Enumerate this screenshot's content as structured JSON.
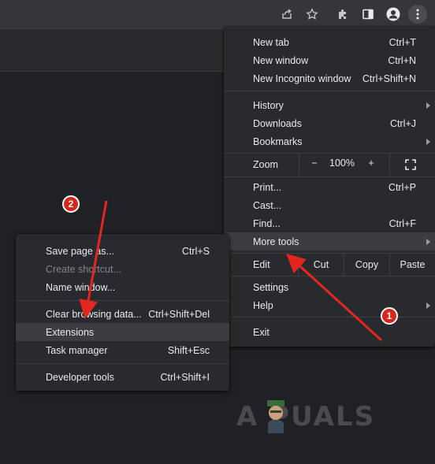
{
  "colors": {
    "background": "#202124",
    "toolbar": "#35363a",
    "menu": "#292a2d",
    "highlight": "#3c3d41",
    "annotation_red": "#d9261c"
  },
  "toolbar": {
    "icons": [
      "share-icon",
      "star-icon",
      "extensions-icon",
      "side-panel-icon",
      "profile-icon",
      "kebab-menu-icon"
    ]
  },
  "main_menu": {
    "new_tab": {
      "label": "New tab",
      "shortcut": "Ctrl+T"
    },
    "new_window": {
      "label": "New window",
      "shortcut": "Ctrl+N"
    },
    "new_incognito": {
      "label": "New Incognito window",
      "shortcut": "Ctrl+Shift+N"
    },
    "history": {
      "label": "History"
    },
    "downloads": {
      "label": "Downloads",
      "shortcut": "Ctrl+J"
    },
    "bookmarks": {
      "label": "Bookmarks"
    },
    "zoom": {
      "label": "Zoom",
      "minus": "−",
      "level": "100%",
      "plus": "+"
    },
    "print": {
      "label": "Print...",
      "shortcut": "Ctrl+P"
    },
    "cast": {
      "label": "Cast..."
    },
    "find": {
      "label": "Find...",
      "shortcut": "Ctrl+F"
    },
    "more_tools": {
      "label": "More tools"
    },
    "edit": {
      "label": "Edit",
      "cut": "Cut",
      "copy": "Copy",
      "paste": "Paste"
    },
    "settings": {
      "label": "Settings"
    },
    "help": {
      "label": "Help"
    },
    "exit": {
      "label": "Exit"
    }
  },
  "sub_menu": {
    "save_page": {
      "label": "Save page as...",
      "shortcut": "Ctrl+S"
    },
    "create_shortcut": {
      "label": "Create shortcut..."
    },
    "name_window": {
      "label": "Name window..."
    },
    "clear_browsing": {
      "label": "Clear browsing data...",
      "shortcut": "Ctrl+Shift+Del"
    },
    "extensions": {
      "label": "Extensions"
    },
    "task_manager": {
      "label": "Task manager",
      "shortcut": "Shift+Esc"
    },
    "developer_tools": {
      "label": "Developer tools",
      "shortcut": "Ctrl+Shift+I"
    }
  },
  "annotations": {
    "step1": "1",
    "step2": "2"
  },
  "watermark": "A  PUALS"
}
